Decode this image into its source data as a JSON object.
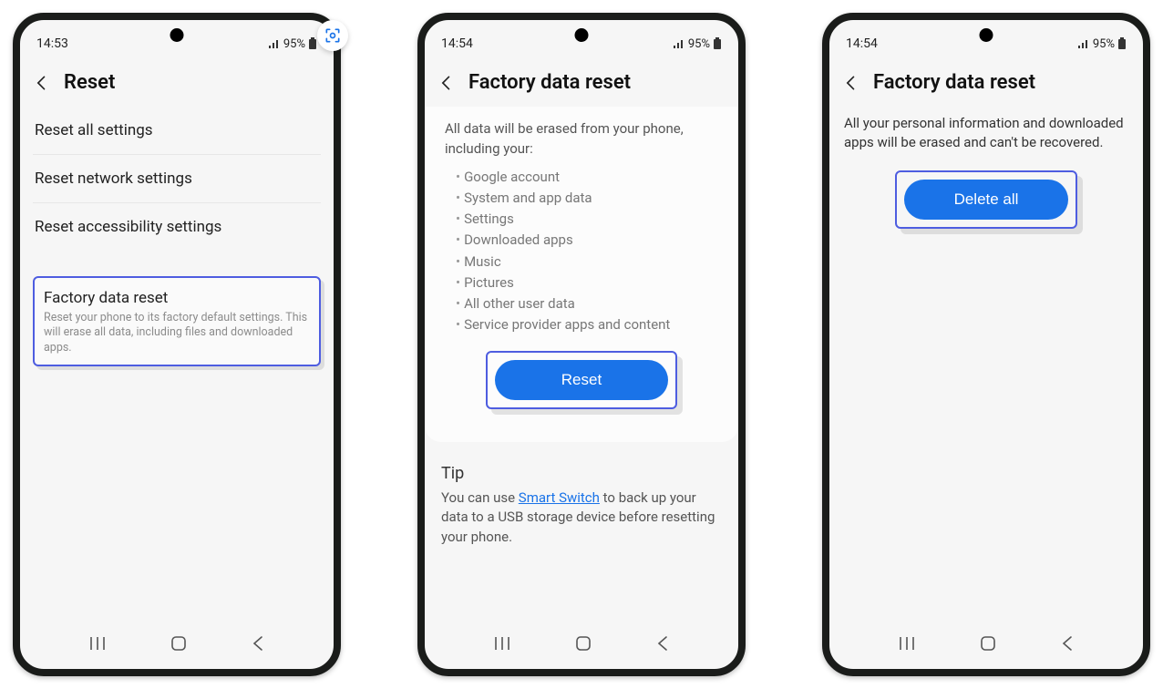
{
  "screen1": {
    "time": "14:53",
    "battery": "95%",
    "title": "Reset",
    "items": [
      "Reset all settings",
      "Reset network settings",
      "Reset accessibility settings"
    ],
    "factory": {
      "title": "Factory data reset",
      "desc": "Reset your phone to its factory default settings. This will erase all data, including files and downloaded apps."
    }
  },
  "screen2": {
    "time": "14:54",
    "battery": "95%",
    "title": "Factory data reset",
    "intro": "All data will be erased from your phone, including your:",
    "bullets": [
      "Google account",
      "System and app data",
      "Settings",
      "Downloaded apps",
      "Music",
      "Pictures",
      "All other user data",
      "Service provider apps and content"
    ],
    "button": "Reset",
    "tip_heading": "Tip",
    "tip_before": "You can use ",
    "tip_link": "Smart Switch",
    "tip_after": " to back up your data to a USB storage device before resetting your phone."
  },
  "screen3": {
    "time": "14:54",
    "battery": "95%",
    "title": "Factory data reset",
    "intro": "All your personal information and downloaded apps will be erased and can't be recovered.",
    "button": "Delete all"
  }
}
